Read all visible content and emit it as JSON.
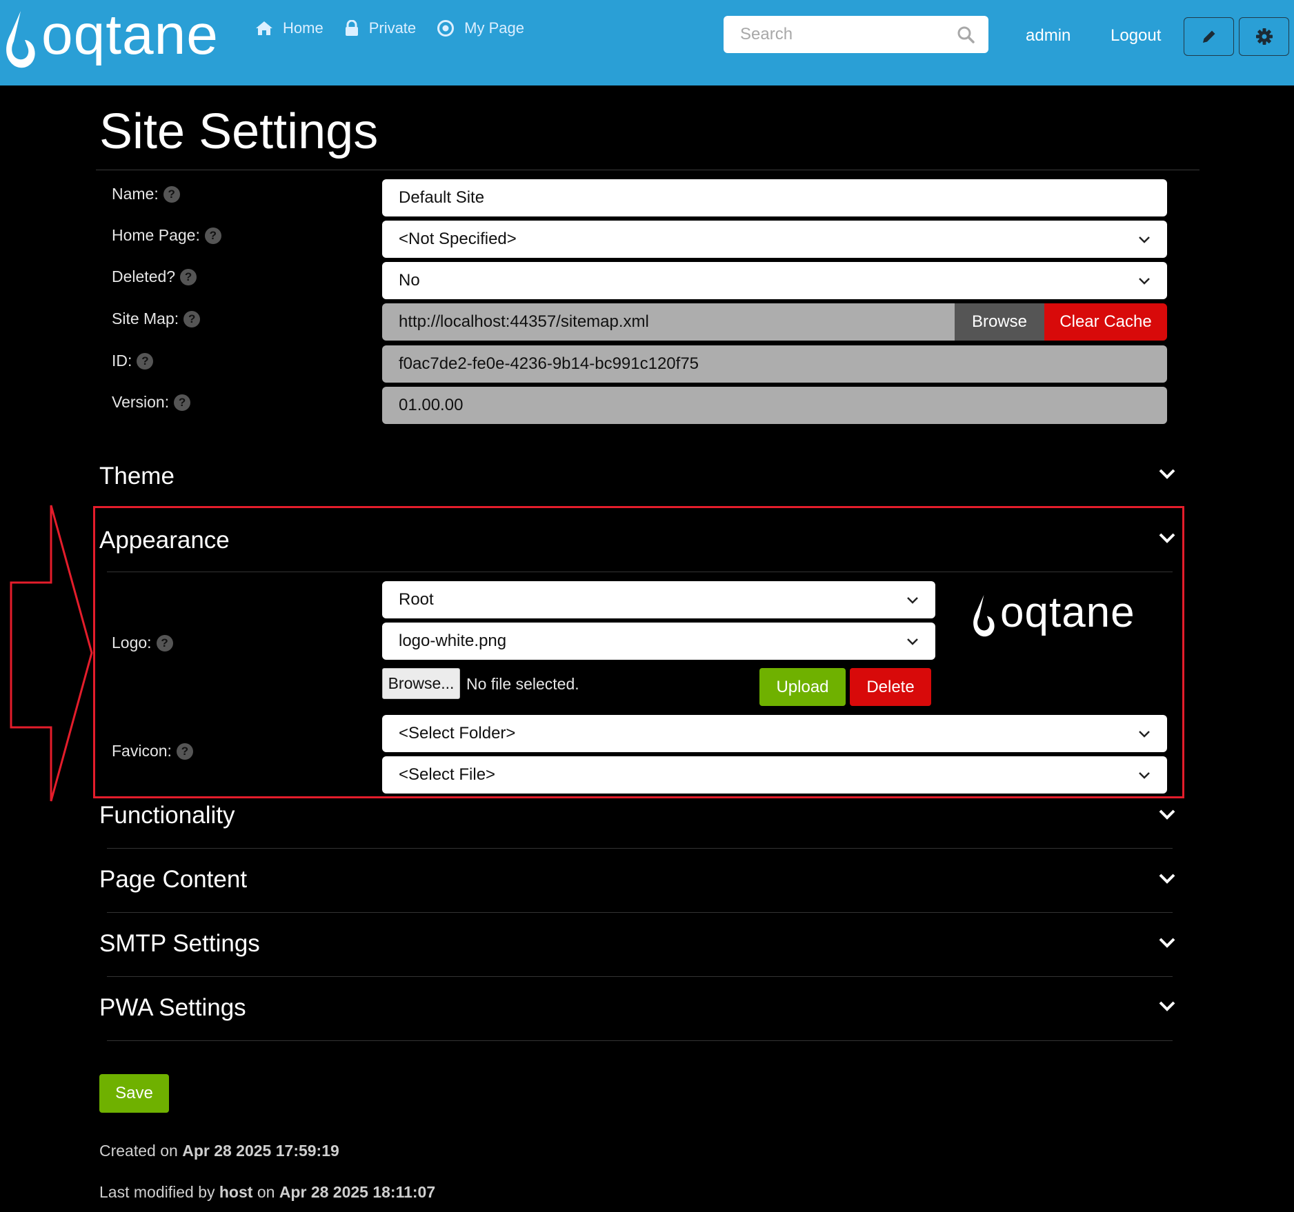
{
  "navbar": {
    "brand": "oqtane",
    "links": [
      {
        "label": "Home",
        "icon": "home-icon"
      },
      {
        "label": "Private",
        "icon": "lock-icon"
      },
      {
        "label": "My Page",
        "icon": "target-icon"
      }
    ],
    "search_placeholder": "Search",
    "user": "admin",
    "logout": "Logout",
    "accent_color": "#2a9fd6"
  },
  "page": {
    "title": "Site Settings"
  },
  "form": {
    "name_label": "Name:",
    "name_value": "Default Site",
    "homepage_label": "Home Page:",
    "homepage_value": "<Not Specified>",
    "deleted_label": "Deleted?",
    "deleted_value": "No",
    "sitemap_label": "Site Map:",
    "sitemap_value": "http://localhost:44357/sitemap.xml",
    "browse_label": "Browse",
    "clear_cache_label": "Clear Cache",
    "id_label": "ID:",
    "id_value": "f0ac7de2-fe0e-4236-9b14-bc991c120f75",
    "version_label": "Version:",
    "version_value": "01.00.00"
  },
  "sections": {
    "theme": "Theme",
    "appearance": "Appearance",
    "functionality": "Functionality",
    "page_content": "Page Content",
    "smtp": "SMTP Settings",
    "pwa": "PWA Settings"
  },
  "appearance": {
    "logo_label": "Logo:",
    "logo_folder": "Root",
    "logo_file": "logo-white.png",
    "file_browse": "Browse...",
    "file_status": "No file selected.",
    "upload_label": "Upload",
    "delete_label": "Delete",
    "logo_preview_text": "oqtane",
    "favicon_label": "Favicon:",
    "favicon_folder": "<Select Folder>",
    "favicon_file": "<Select File>"
  },
  "footer": {
    "save_label": "Save",
    "created_prefix": "Created on ",
    "created_date": "Apr 28 2025 17:59:19",
    "modified_prefix": "Last modified by ",
    "modified_user": "host",
    "modified_mid": " on ",
    "modified_date": "Apr 28 2025 18:11:07"
  },
  "colors": {
    "success": "#6fb100",
    "danger": "#d80a0a",
    "secondary": "#555555",
    "highlight": "#e41d2b"
  }
}
